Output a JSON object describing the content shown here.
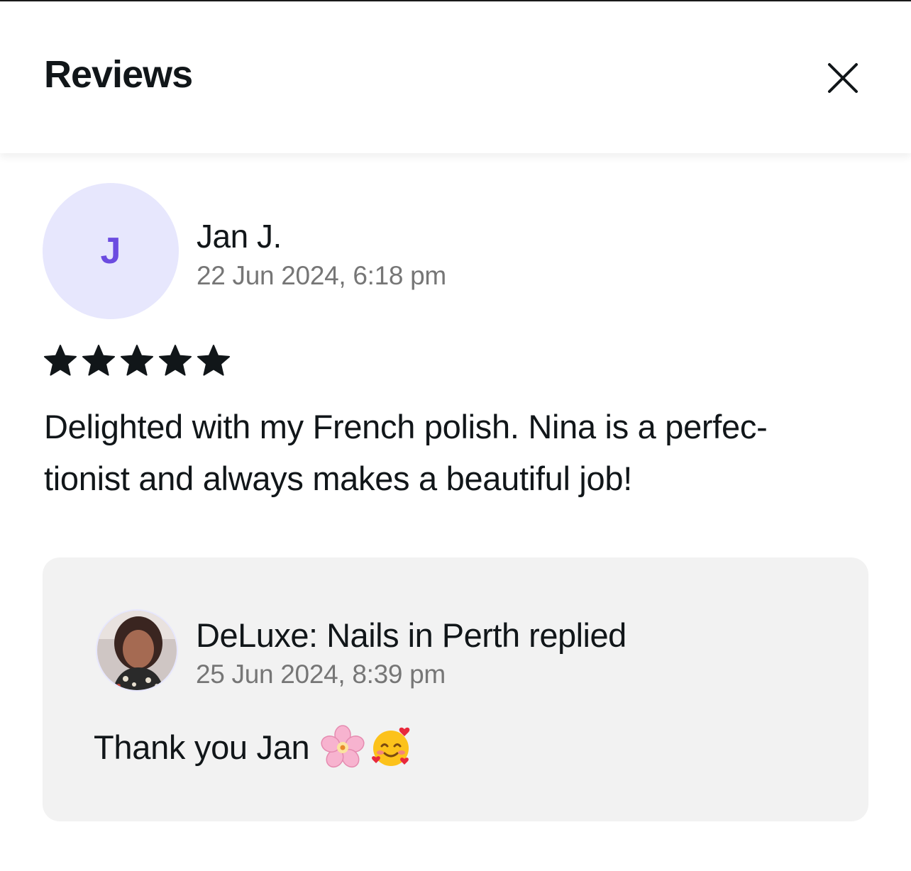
{
  "header": {
    "title": "Reviews",
    "close_icon": "close-icon"
  },
  "review": {
    "avatar_initial": "J",
    "reviewer_name": "Jan J.",
    "date": "22 Jun 2024, 6:18 pm",
    "rating": 5,
    "rating_max": 5,
    "text": "Delighted with my French polish. Nina is a perfec-tionist and always makes a beautiful job!"
  },
  "reply": {
    "avatar_icon": "business-owner-photo",
    "author": "DeLuxe: Nails in Perth replied",
    "date": "25 Jun 2024, 8:39 pm",
    "text": "Thank you Jan",
    "emojis": [
      "cherry-blossom-emoji",
      "smiling-face-with-hearts-emoji"
    ]
  },
  "colors": {
    "avatar_bg": "#e7e7fd",
    "avatar_initial": "#6c4ce0",
    "reply_bg": "#f2f2f2",
    "secondary_text": "#767676",
    "primary_text": "#111619"
  }
}
